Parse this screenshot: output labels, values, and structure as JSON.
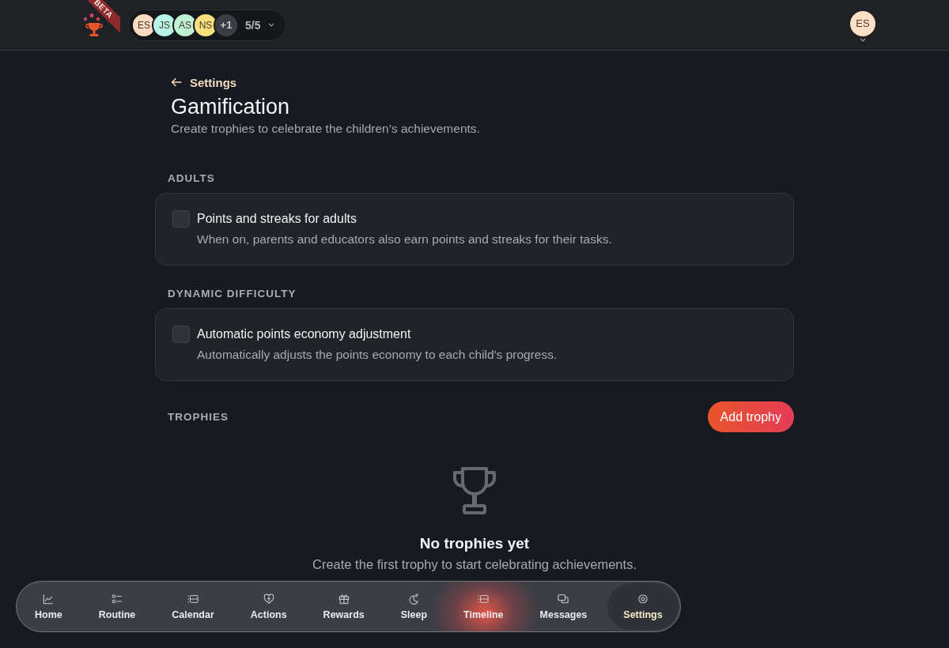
{
  "header": {
    "beta_label": "BETA",
    "members": [
      {
        "initials": "ES",
        "kind": "person",
        "color": "#fddcc3"
      },
      {
        "initials": "JS",
        "kind": "person",
        "color": "#b9f3e6"
      },
      {
        "initials": "AS",
        "kind": "person",
        "color": "#bff2d2"
      },
      {
        "initials": "NS",
        "kind": "person",
        "color": "#f8e07e"
      },
      {
        "initials": "+1",
        "kind": "count",
        "color": "#3a3d43"
      }
    ],
    "member_count": "5/5",
    "user": {
      "initials": "ES"
    }
  },
  "page": {
    "back_label": "Settings",
    "title": "Gamification",
    "subtitle": "Create trophies to celebrate the children’s achievements."
  },
  "sections": [
    {
      "heading": "ADULTS",
      "options": [
        {
          "label": "Points and streaks for adults",
          "description": "When on, parents and educators also earn points and streaks for their tasks.",
          "checked": false
        }
      ]
    },
    {
      "heading": "DYNAMIC DIFFICULTY",
      "options": [
        {
          "label": "Automatic points economy adjustment",
          "description": "Automatically adjusts the points economy to each child's progress.",
          "checked": false
        }
      ]
    }
  ],
  "trophies": {
    "heading": "TROPHIES",
    "add_button": "Add trophy",
    "empty_title": "No trophies yet",
    "empty_text": "Create the first trophy to start celebrating achievements."
  },
  "nav": [
    {
      "label": "Home",
      "kind": "chart",
      "selected": false
    },
    {
      "label": "Routine",
      "kind": "checklist",
      "selected": false
    },
    {
      "label": "Calendar",
      "kind": "calendar",
      "selected": false
    },
    {
      "label": "Actions",
      "kind": "heart",
      "selected": false
    },
    {
      "label": "Rewards",
      "kind": "gift",
      "selected": false
    },
    {
      "label": "Sleep",
      "kind": "moon",
      "selected": false
    },
    {
      "label": "Timeline",
      "kind": "timeline",
      "selected": false
    },
    {
      "label": "Messages",
      "kind": "chat",
      "selected": false
    },
    {
      "label": "Settings",
      "kind": "gear",
      "selected": true
    }
  ]
}
